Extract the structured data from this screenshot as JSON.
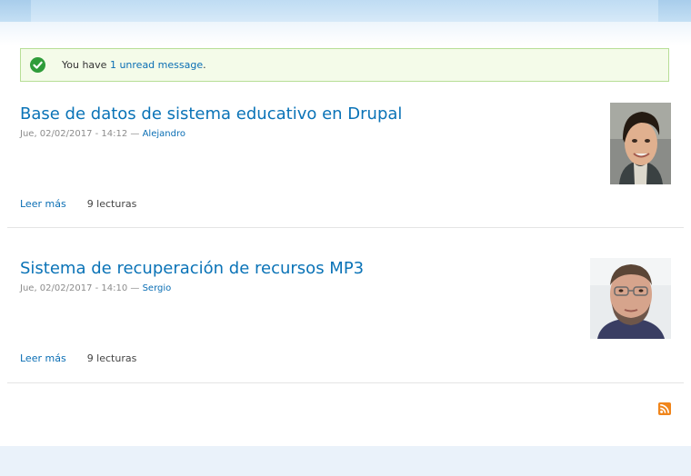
{
  "status": {
    "prefix": "You have ",
    "link": "1 unread message",
    "suffix": ".",
    "icon": "check-icon"
  },
  "nodes": [
    {
      "title": "Base de datos de sistema educativo en Drupal",
      "date": "Jue, 02/02/2017 - 14:12",
      "separator": " — ",
      "author": "Alejandro",
      "read_more": "Leer más",
      "reads": "9 lecturas"
    },
    {
      "title": "Sistema de recuperación de recursos MP3",
      "date": "Jue, 02/02/2017 - 14:10",
      "separator": " — ",
      "author": "Sergio",
      "read_more": "Leer más",
      "reads": "9 lecturas"
    }
  ],
  "feed": {
    "icon": "rss-icon"
  },
  "colors": {
    "link": "#0a6eb4",
    "status_border": "#b7de96",
    "status_bg": "#f4fbe9",
    "check": "#2f9c3a",
    "rss": "#f0851b"
  }
}
